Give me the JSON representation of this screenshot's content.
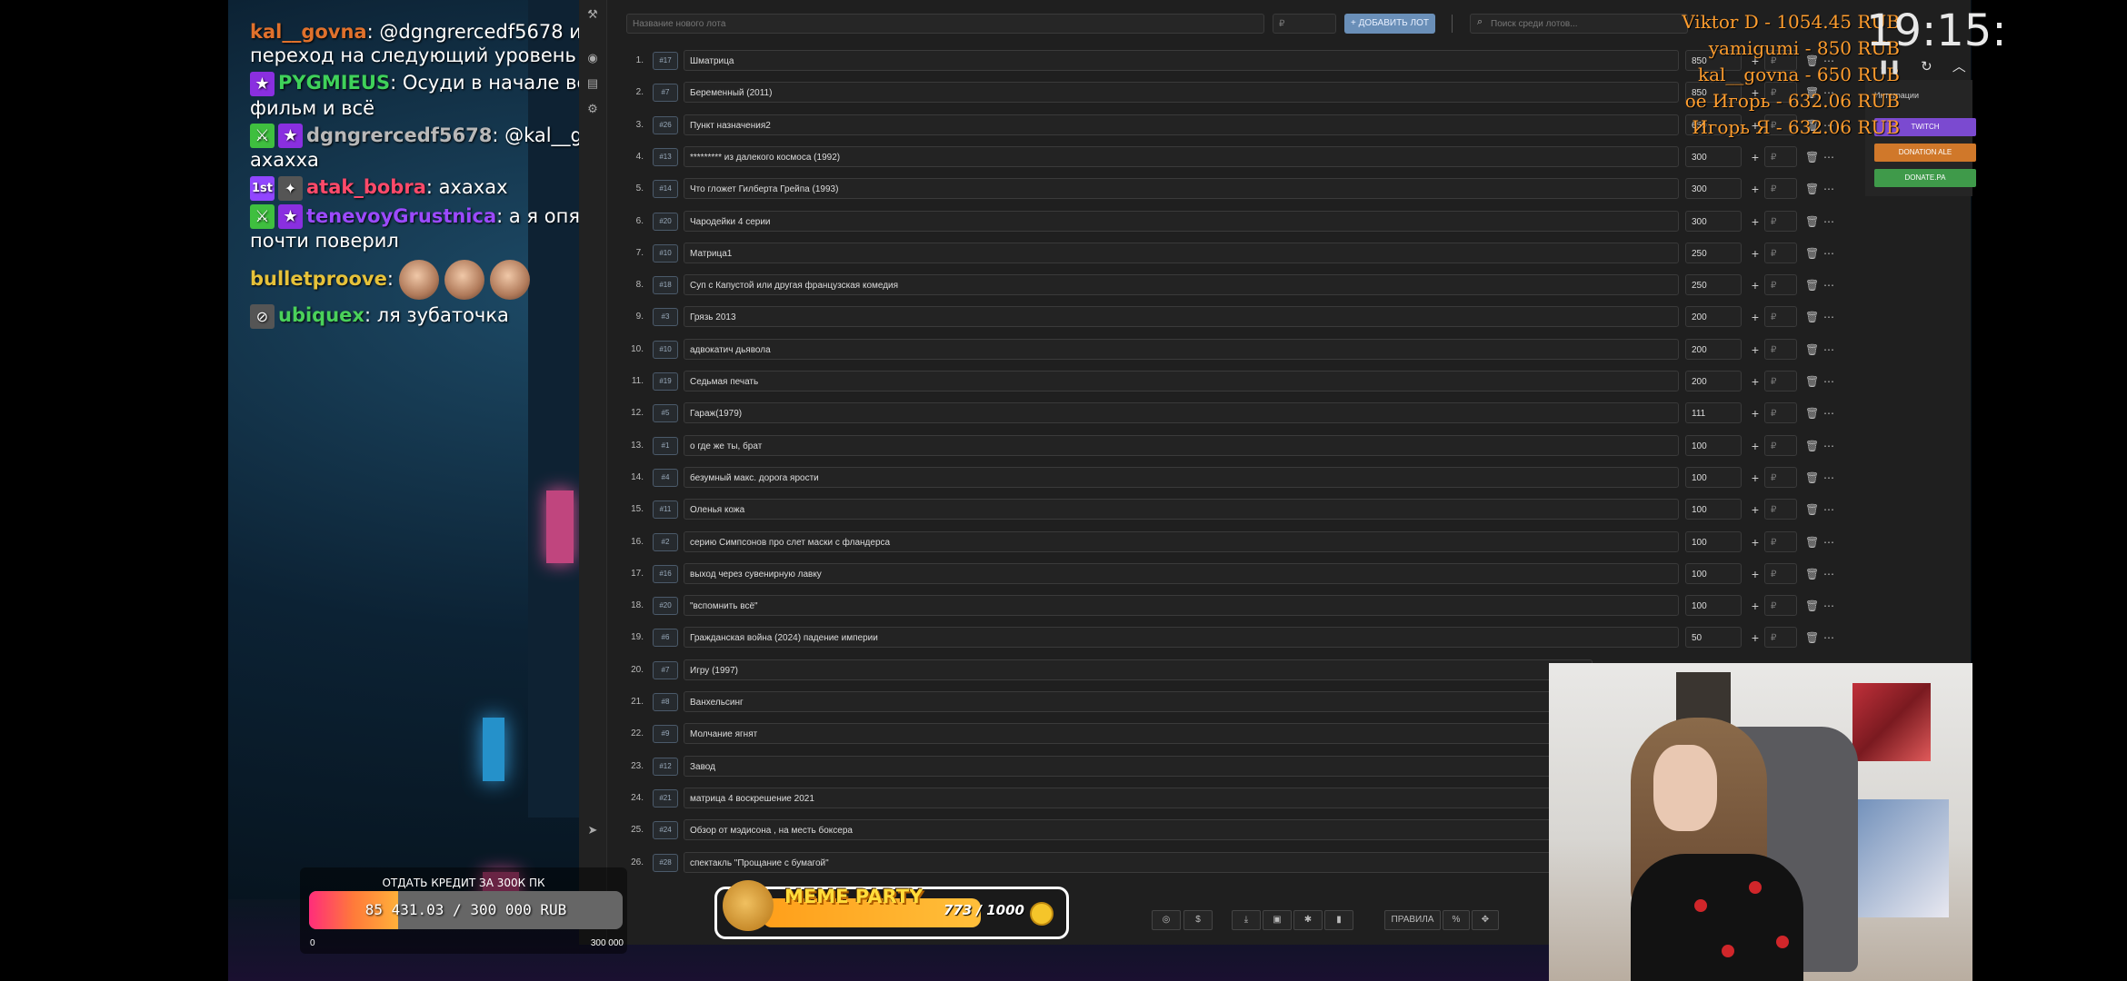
{
  "chat": [
    {
      "user": "kal__govna",
      "color": "#e0712c",
      "badges": [],
      "text": ": @dgngrercedf5678 и переход на следующий уровень"
    },
    {
      "user": "PYGMIEUS",
      "color": "#3fd15a",
      "badges": [
        "star-icon"
      ],
      "text": ": Осуди в начале весь фильм и всё"
    },
    {
      "user": "dgngrercedf5678",
      "color": "#b8b8b8",
      "badges": [
        "sword-icon",
        "star-icon"
      ],
      "text": ": @kal__govna ахахха"
    },
    {
      "user": "atak_bobra",
      "color": "#ff4a6a",
      "badges": [
        "first-icon",
        "emblem-icon"
      ],
      "text": ": ахахах"
    },
    {
      "user": "tenevoyGrustnica",
      "color": "#9b4aff",
      "badges": [
        "sword-icon",
        "star-icon"
      ],
      "text": ": а я опять почти поверил"
    },
    {
      "user": "bulletproove",
      "color": "#e6c23a",
      "badges": [],
      "text": ":"
    },
    {
      "user": "ubiquex",
      "color": "#4ad15a",
      "badges": [
        "hidden-icon"
      ],
      "text": ": ля зубаточка"
    }
  ],
  "auction": {
    "name_placeholder": "Название нового лота",
    "amount_placeholder": "₽",
    "add_button": "+ ДОБАВИТЬ ЛОТ",
    "search_placeholder": "Поиск среди лотов...",
    "lots": [
      {
        "n": "1.",
        "id": "#17",
        "name": "Шматрица",
        "amount": "850"
      },
      {
        "n": "2.",
        "id": "#7",
        "name": "Беременный (2011)",
        "amount": "850"
      },
      {
        "n": "3.",
        "id": "#26",
        "name": "Пункт назначения2",
        "amount": "650"
      },
      {
        "n": "4.",
        "id": "#13",
        "name": "********* из далекого космоса (1992)",
        "amount": "300"
      },
      {
        "n": "5.",
        "id": "#14",
        "name": "Что гложет Гилберта Грейпа (1993)",
        "amount": "300"
      },
      {
        "n": "6.",
        "id": "#20",
        "name": "Чародейки 4 серии",
        "amount": "300"
      },
      {
        "n": "7.",
        "id": "#10",
        "name": "Матрица1",
        "amount": "250"
      },
      {
        "n": "8.",
        "id": "#18",
        "name": "Суп с Капустой или другая французская комедия",
        "amount": "250"
      },
      {
        "n": "9.",
        "id": "#3",
        "name": "Грязь 2013",
        "amount": "200"
      },
      {
        "n": "10.",
        "id": "#10",
        "name": "адвокатич дьявола",
        "amount": "200"
      },
      {
        "n": "11.",
        "id": "#19",
        "name": "Седьмая печать",
        "amount": "200"
      },
      {
        "n": "12.",
        "id": "#5",
        "name": "Гараж(1979)",
        "amount": "111"
      },
      {
        "n": "13.",
        "id": "#1",
        "name": "о где же ты, брат",
        "amount": "100"
      },
      {
        "n": "14.",
        "id": "#4",
        "name": "безумный макс. дорога ярости",
        "amount": "100"
      },
      {
        "n": "15.",
        "id": "#11",
        "name": "Оленья кожа",
        "amount": "100"
      },
      {
        "n": "16.",
        "id": "#2",
        "name": "серию Симпсонов про слет маски с фландерса",
        "amount": "100"
      },
      {
        "n": "17.",
        "id": "#16",
        "name": "выход через сувенирную лавку",
        "amount": "100"
      },
      {
        "n": "18.",
        "id": "#20",
        "name": "\"вспомнить всё\"",
        "amount": "100"
      },
      {
        "n": "19.",
        "id": "#6",
        "name": "Гражданская война (2024) падение империи",
        "amount": "50"
      },
      {
        "n": "20.",
        "id": "#7",
        "name": "Игру (1997)",
        "amount": ""
      },
      {
        "n": "21.",
        "id": "#8",
        "name": "Ванхельсинг",
        "amount": ""
      },
      {
        "n": "22.",
        "id": "#9",
        "name": "Молчание ягнят",
        "amount": ""
      },
      {
        "n": "23.",
        "id": "#12",
        "name": "Завод",
        "amount": ""
      },
      {
        "n": "24.",
        "id": "#21",
        "name": "матрица 4 воскрешение 2021",
        "amount": ""
      },
      {
        "n": "25.",
        "id": "#24",
        "name": "Обзор от мэдисона , на месть боксера",
        "amount": ""
      },
      {
        "n": "26.",
        "id": "#28",
        "name": "спектакль \"Прощание с бумагой\"",
        "amount": ""
      }
    ]
  },
  "integrations": {
    "title": "Интеграции",
    "buttons": [
      {
        "label": "TWITCH",
        "color": "#7b4ad0"
      },
      {
        "label": "DONATION ALE",
        "color": "#d0782a"
      },
      {
        "label": "DONATE.PA",
        "color": "#3f9a4a"
      }
    ]
  },
  "donors": [
    "Viktor D - 1054.45 RUB",
    "yamigumi - 850 RUB",
    "kal__govna - 650 RUB",
    "ое Игорь - 632.06 RUB",
    "Игорь Я - 632.06 RUB"
  ],
  "clock": "19:15:",
  "goal": {
    "title": "ОТДАТЬ КРЕДИТ ЗА 300К ПК",
    "label": "85 431.03 / 300 000 RUB",
    "progress": 0.285,
    "min": "0",
    "max": "300 000"
  },
  "meme": {
    "title": "MEME PARTY",
    "value": "773 / 1000",
    "progress": 0.773
  },
  "footer": {
    "rules_label": "ПРАВИЛА"
  }
}
